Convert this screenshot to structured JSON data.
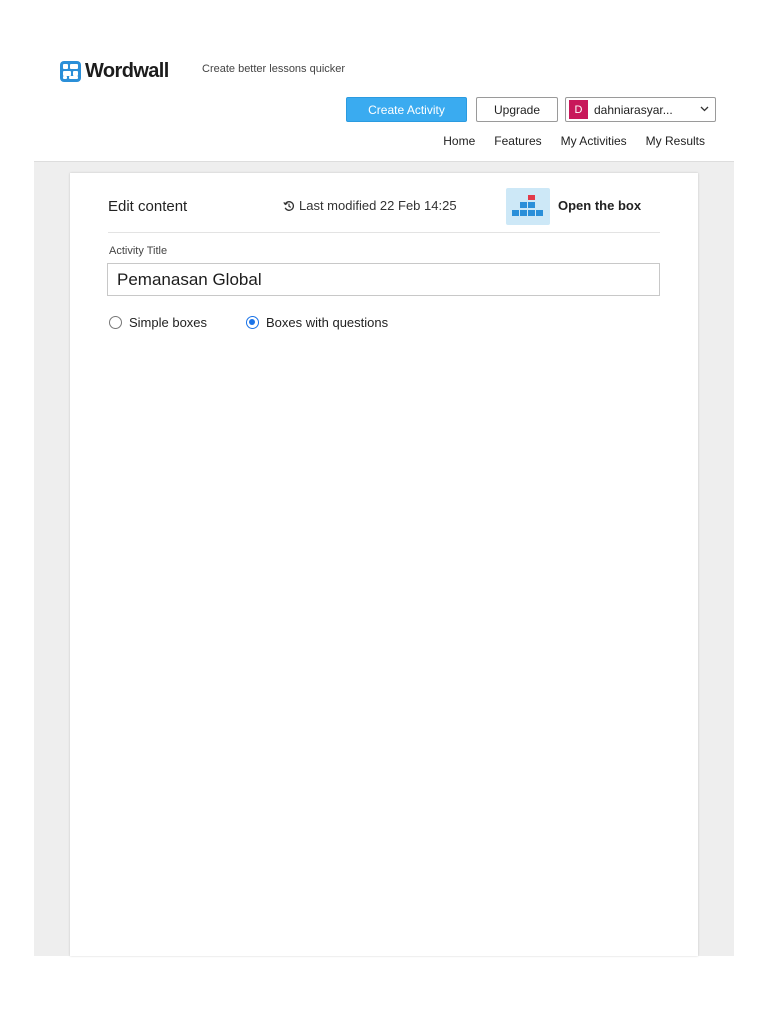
{
  "header": {
    "brand": "Wordwall",
    "tagline": "Create better lessons quicker",
    "create_label": "Create Activity",
    "upgrade_label": "Upgrade",
    "user": {
      "initial": "D",
      "name": "dahniarasyar...",
      "avatar_color": "#c8185a"
    }
  },
  "nav": {
    "items": [
      "Home",
      "Features",
      "My Activities",
      "My Results"
    ]
  },
  "editor": {
    "heading": "Edit content",
    "last_modified": "Last modified 22 Feb 14:25",
    "template_name": "Open the box",
    "title_label": "Activity Title",
    "title_value": "Pemanasan Global",
    "options": [
      {
        "label": "Simple boxes",
        "checked": false
      },
      {
        "label": "Boxes with questions",
        "checked": true
      }
    ]
  },
  "colors": {
    "accent": "#3aabf0",
    "radio_selected": "#1a73e8",
    "brand_icon": "#2b8fd8"
  }
}
